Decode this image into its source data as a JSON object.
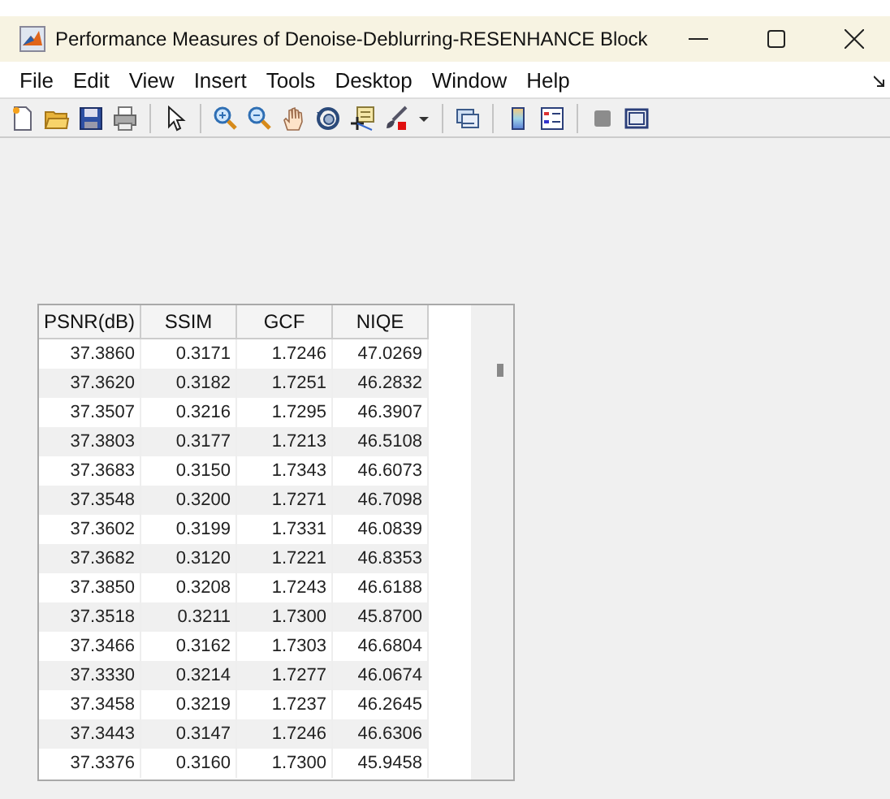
{
  "window": {
    "title": "Performance Measures of Denoise-Deblurring-RESENHANCE Block"
  },
  "menu": [
    "File",
    "Edit",
    "View",
    "Insert",
    "Tools",
    "Desktop",
    "Window",
    "Help"
  ],
  "toolbar": [
    {
      "kind": "new"
    },
    {
      "kind": "open"
    },
    {
      "kind": "save"
    },
    {
      "kind": "print"
    },
    {
      "kind": "sep"
    },
    {
      "kind": "pointer"
    },
    {
      "kind": "sep"
    },
    {
      "kind": "zoomin"
    },
    {
      "kind": "zoomout"
    },
    {
      "kind": "pan"
    },
    {
      "kind": "rotate"
    },
    {
      "kind": "datatip"
    },
    {
      "kind": "brush"
    },
    {
      "kind": "caret"
    },
    {
      "kind": "sep"
    },
    {
      "kind": "link"
    },
    {
      "kind": "sep"
    },
    {
      "kind": "colorbar"
    },
    {
      "kind": "legend"
    },
    {
      "kind": "sep"
    },
    {
      "kind": "hide"
    },
    {
      "kind": "dock"
    }
  ],
  "table": {
    "columns": [
      "PSNR(dB)",
      "SSIM",
      "GCF",
      "NIQE"
    ],
    "rows": [
      [
        "37.3860",
        "0.3171",
        "1.7246",
        "47.0269"
      ],
      [
        "37.3620",
        "0.3182",
        "1.7251",
        "46.2832"
      ],
      [
        "37.3507",
        "0.3216",
        "1.7295",
        "46.3907"
      ],
      [
        "37.3803",
        "0.3177",
        "1.7213",
        "46.5108"
      ],
      [
        "37.3683",
        "0.3150",
        "1.7343",
        "46.6073"
      ],
      [
        "37.3548",
        "0.3200",
        "1.7271",
        "46.7098"
      ],
      [
        "37.3602",
        "0.3199",
        "1.7331",
        "46.0839"
      ],
      [
        "37.3682",
        "0.3120",
        "1.7221",
        "46.8353"
      ],
      [
        "37.3850",
        "0.3208",
        "1.7243",
        "46.6188"
      ],
      [
        "37.3518",
        "0.3211",
        "1.7300",
        "45.8700"
      ],
      [
        "37.3466",
        "0.3162",
        "1.7303",
        "46.6804"
      ],
      [
        "37.3330",
        "0.3214",
        "1.7277",
        "46.0674"
      ],
      [
        "37.3458",
        "0.3219",
        "1.7237",
        "46.2645"
      ],
      [
        "37.3443",
        "0.3147",
        "1.7246",
        "46.6306"
      ],
      [
        "37.3376",
        "0.3160",
        "1.7300",
        "45.9458"
      ]
    ]
  }
}
